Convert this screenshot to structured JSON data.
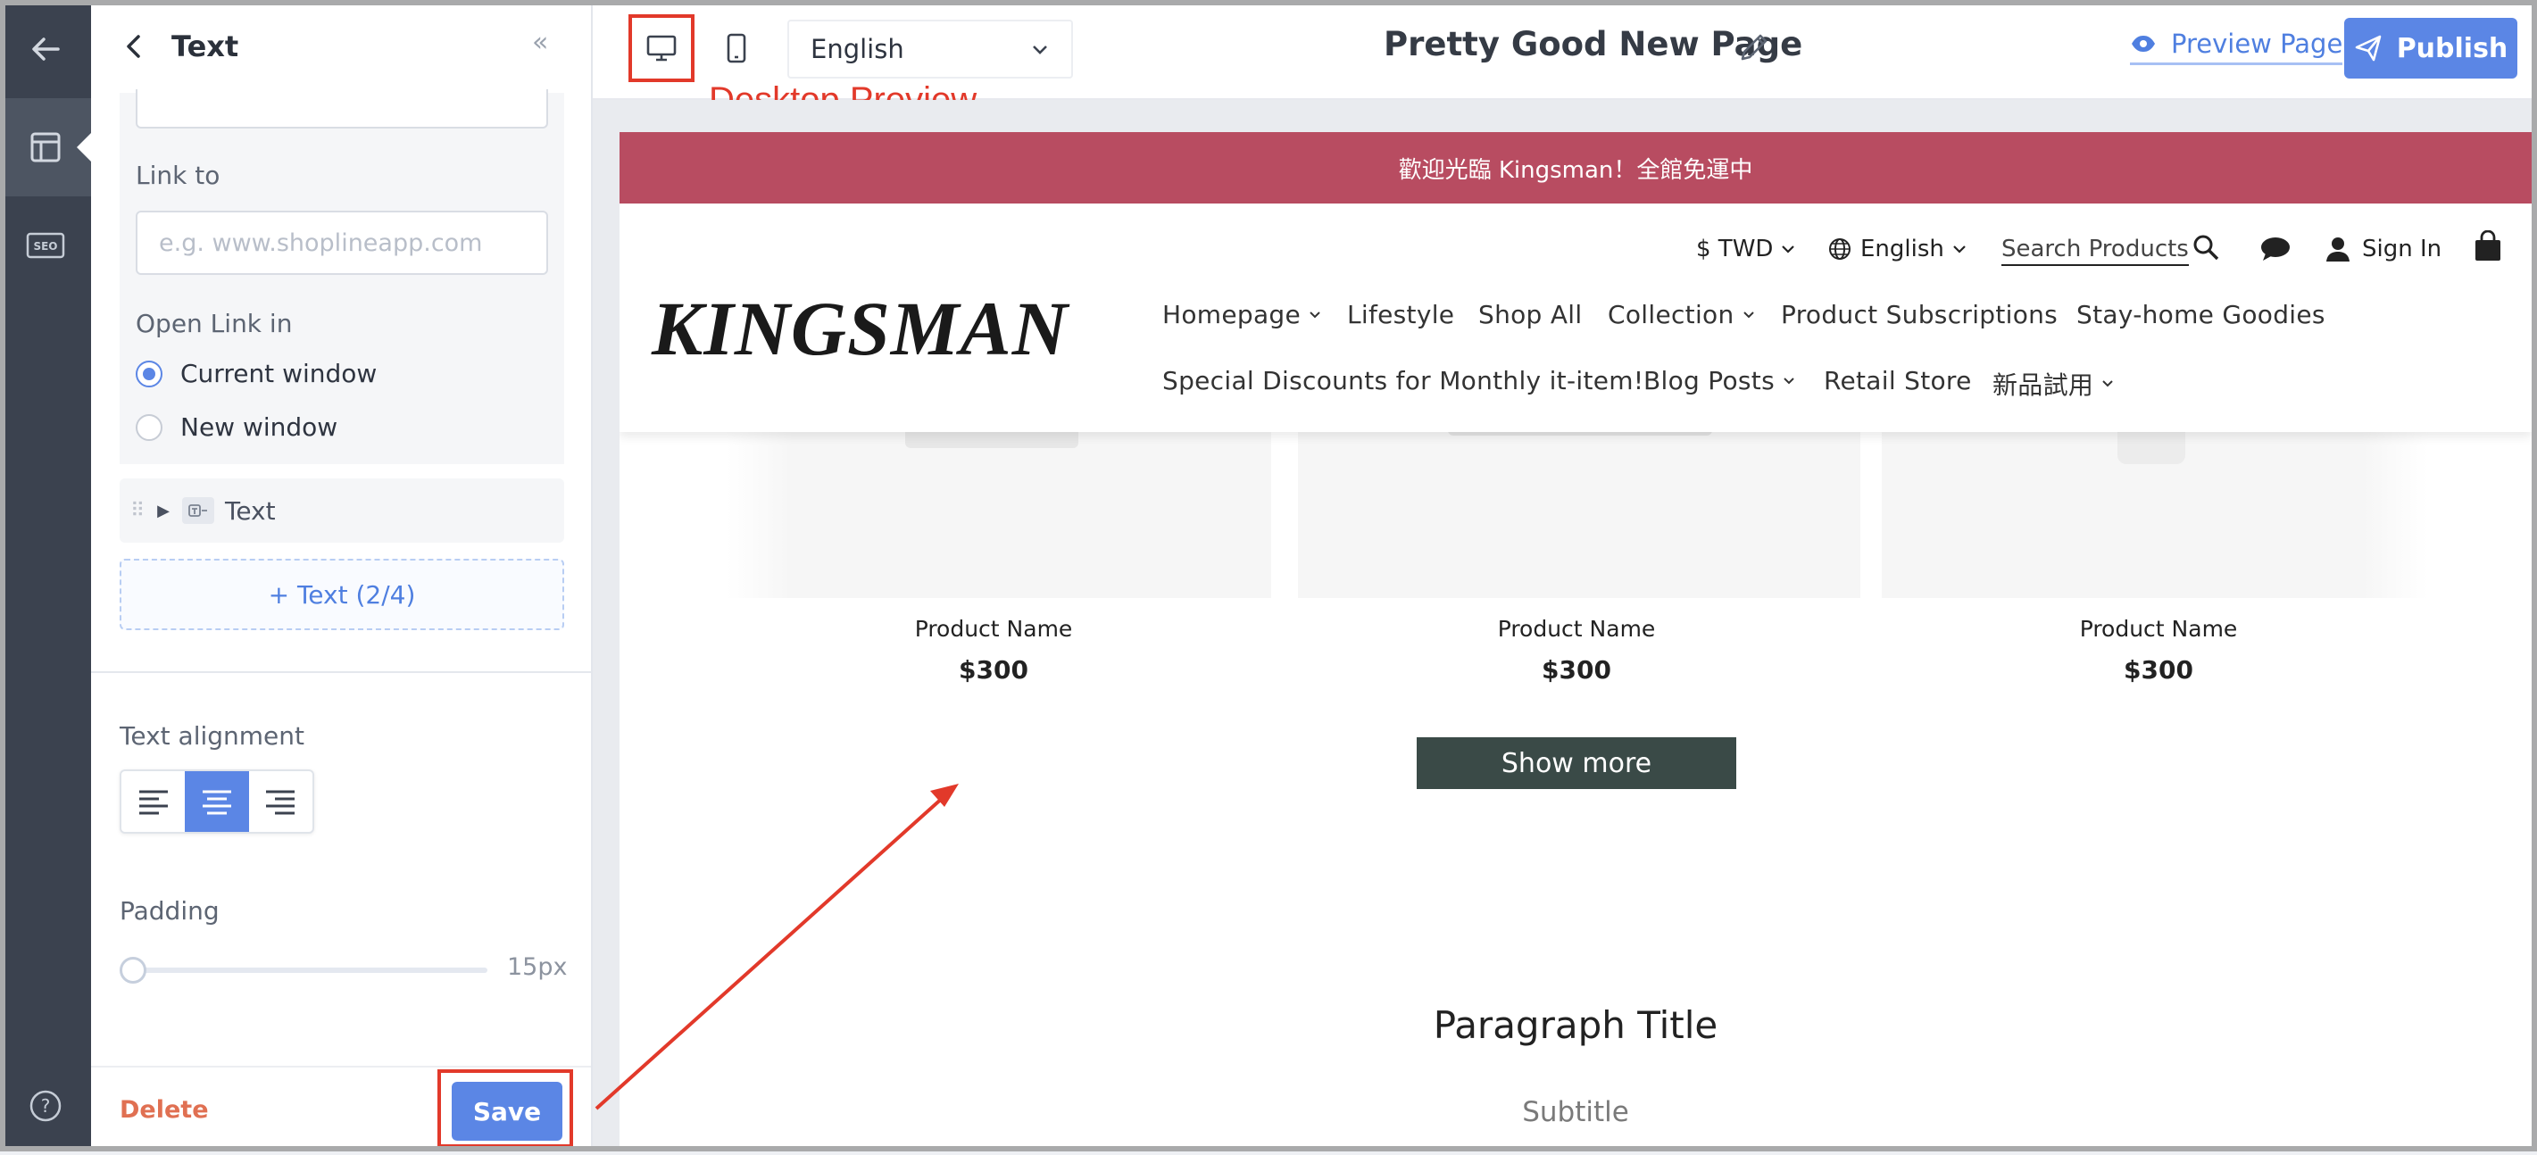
{
  "rail": {
    "items": [
      {
        "name": "back-arrow-icon"
      },
      {
        "name": "layout-icon",
        "active": true
      },
      {
        "name": "seo-icon",
        "label": "SEO"
      },
      {
        "name": "help-icon"
      }
    ]
  },
  "panel": {
    "title": "Text",
    "link_to_label": "Link to",
    "link_placeholder": "e.g. www.shoplineapp.com",
    "open_link_label": "Open Link in",
    "options": [
      {
        "label": "Current window",
        "selected": true
      },
      {
        "label": "New window",
        "selected": false
      }
    ],
    "tree_item": "Text",
    "add_text": "+ Text (2/4)",
    "alignment_label": "Text alignment",
    "alignment_selected": "center",
    "padding_label": "Padding",
    "padding_value": "15px",
    "delete_label": "Delete",
    "save_label": "Save"
  },
  "toolbar": {
    "language": "English",
    "page_title": "Pretty Good New Page",
    "preview_label": "Preview Page",
    "publish_label": "Publish",
    "annotation": "Desktop Preview"
  },
  "site": {
    "promo": "歡迎光臨 Kingsman！全館免運中",
    "currency": "$ TWD",
    "language": "English",
    "search": "Search Products",
    "sign_in": "Sign In",
    "logo": "KINGSMAN",
    "nav_row1": [
      "Homepage",
      "Lifestyle",
      "Shop All",
      "Collection",
      "Product Subscriptions",
      "Stay-home Goodies"
    ],
    "nav_row2": [
      "Special Discounts for Monthly it-item!",
      "Blog Posts",
      "Retail Store",
      "新品試用"
    ],
    "products": [
      {
        "name": "Product Name",
        "price": "$300"
      },
      {
        "name": "Product Name",
        "price": "$300"
      },
      {
        "name": "Product Name",
        "price": "$300"
      }
    ],
    "show_more": "Show more",
    "paragraph_title": "Paragraph Title",
    "subtitle": "Subtitle"
  },
  "colors": {
    "accent": "#5b86e5",
    "promo_bar": "#b84c61",
    "annotation_red": "#e2392a",
    "show_more_bg": "#3a4a47"
  }
}
